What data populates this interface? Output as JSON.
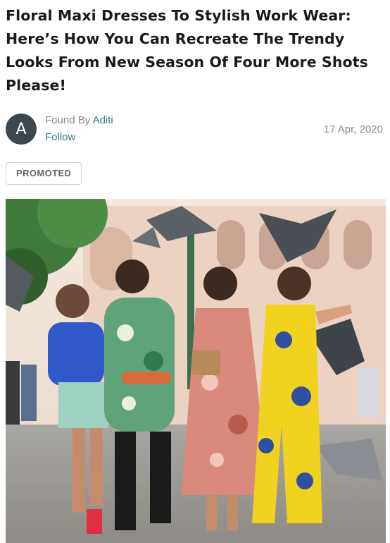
{
  "article": {
    "title": "Floral Maxi Dresses To Stylish Work Wear: Here’s How You Can Recreate The Trendy Looks From New Season Of Four More Shots Please!",
    "avatar_letter": "A",
    "found_by_label": "Found By",
    "author": "Aditi",
    "follow_label": "Follow",
    "date": "17 Apr, 2020",
    "badge": "PROMOTED"
  },
  "colors": {
    "link": "#2f7f86",
    "avatar_bg": "#3d4750"
  }
}
